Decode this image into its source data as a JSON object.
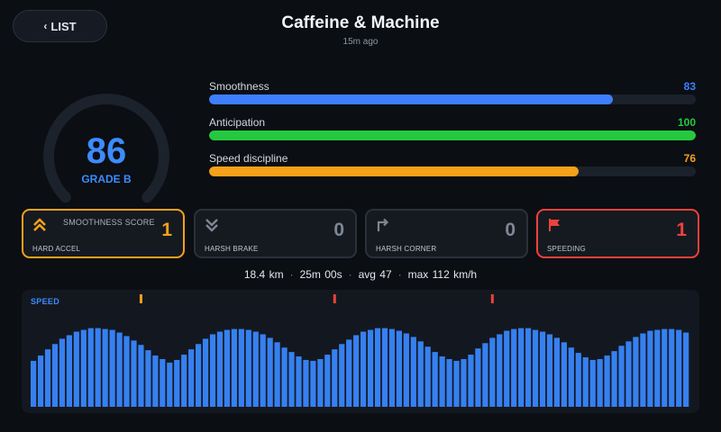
{
  "header": {
    "back_label": "LIST",
    "title": "Caffeine & Machine",
    "subtitle": "15m ago"
  },
  "score": {
    "value": "86",
    "grade": "GRADE B",
    "fraction": 0.86,
    "color": "#3d8bff"
  },
  "metrics": [
    {
      "label": "Smoothness",
      "value": "83",
      "percent": 83,
      "color": "#3d7fff"
    },
    {
      "label": "Anticipation",
      "value": "100",
      "percent": 100,
      "color": "#25c93f"
    },
    {
      "label": "Speed discipline",
      "value": "76",
      "percent": 76,
      "color": "#f5a119"
    }
  ],
  "events": [
    {
      "label": "HARD ACCEL",
      "count": "1",
      "icon": "double-chevron-up-icon",
      "state": "warning",
      "color": "#f5a119",
      "sublabel": "SMOOTHNESS SCORE"
    },
    {
      "label": "HARSH BRAKE",
      "count": "0",
      "icon": "double-chevron-down-icon",
      "state": "none",
      "color": "#6f7986"
    },
    {
      "label": "HARSH CORNER",
      "count": "0",
      "icon": "turn-arrow-icon",
      "state": "none",
      "color": "#6f7986"
    },
    {
      "label": "SPEEDING",
      "count": "1",
      "icon": "flag-icon",
      "state": "alert",
      "color": "#f0413b"
    }
  ],
  "summary": {
    "distance": "18.4 km",
    "duration": "25m 00s",
    "avg": "avg 47",
    "max": "max 112 km/h"
  },
  "chart_data": {
    "type": "bar",
    "title": "SPEED",
    "color": "#3680f0",
    "ylim": [
      0,
      112
    ],
    "values": [
      52,
      58,
      65,
      71,
      77,
      81,
      85,
      87,
      89,
      89,
      88,
      87,
      84,
      80,
      75,
      70,
      64,
      58,
      54,
      50,
      53,
      59,
      65,
      71,
      77,
      82,
      85,
      87,
      88,
      88,
      87,
      85,
      82,
      78,
      73,
      67,
      62,
      57,
      53,
      52,
      54,
      59,
      65,
      71,
      76,
      81,
      85,
      87,
      89,
      89,
      88,
      86,
      83,
      79,
      74,
      68,
      62,
      57,
      54,
      52,
      54,
      59,
      66,
      72,
      78,
      82,
      86,
      88,
      89,
      89,
      87,
      85,
      82,
      78,
      73,
      67,
      61,
      56,
      53,
      54,
      58,
      63,
      69,
      74,
      79,
      83,
      86,
      87,
      88,
      88,
      87,
      84
    ],
    "events": [
      {
        "index": 15,
        "type": "hard-accel",
        "color": "#f5a119"
      },
      {
        "index": 42,
        "type": "speeding",
        "color": "#f0413b"
      },
      {
        "index": 64,
        "type": "speeding",
        "color": "#f0413b"
      }
    ]
  }
}
